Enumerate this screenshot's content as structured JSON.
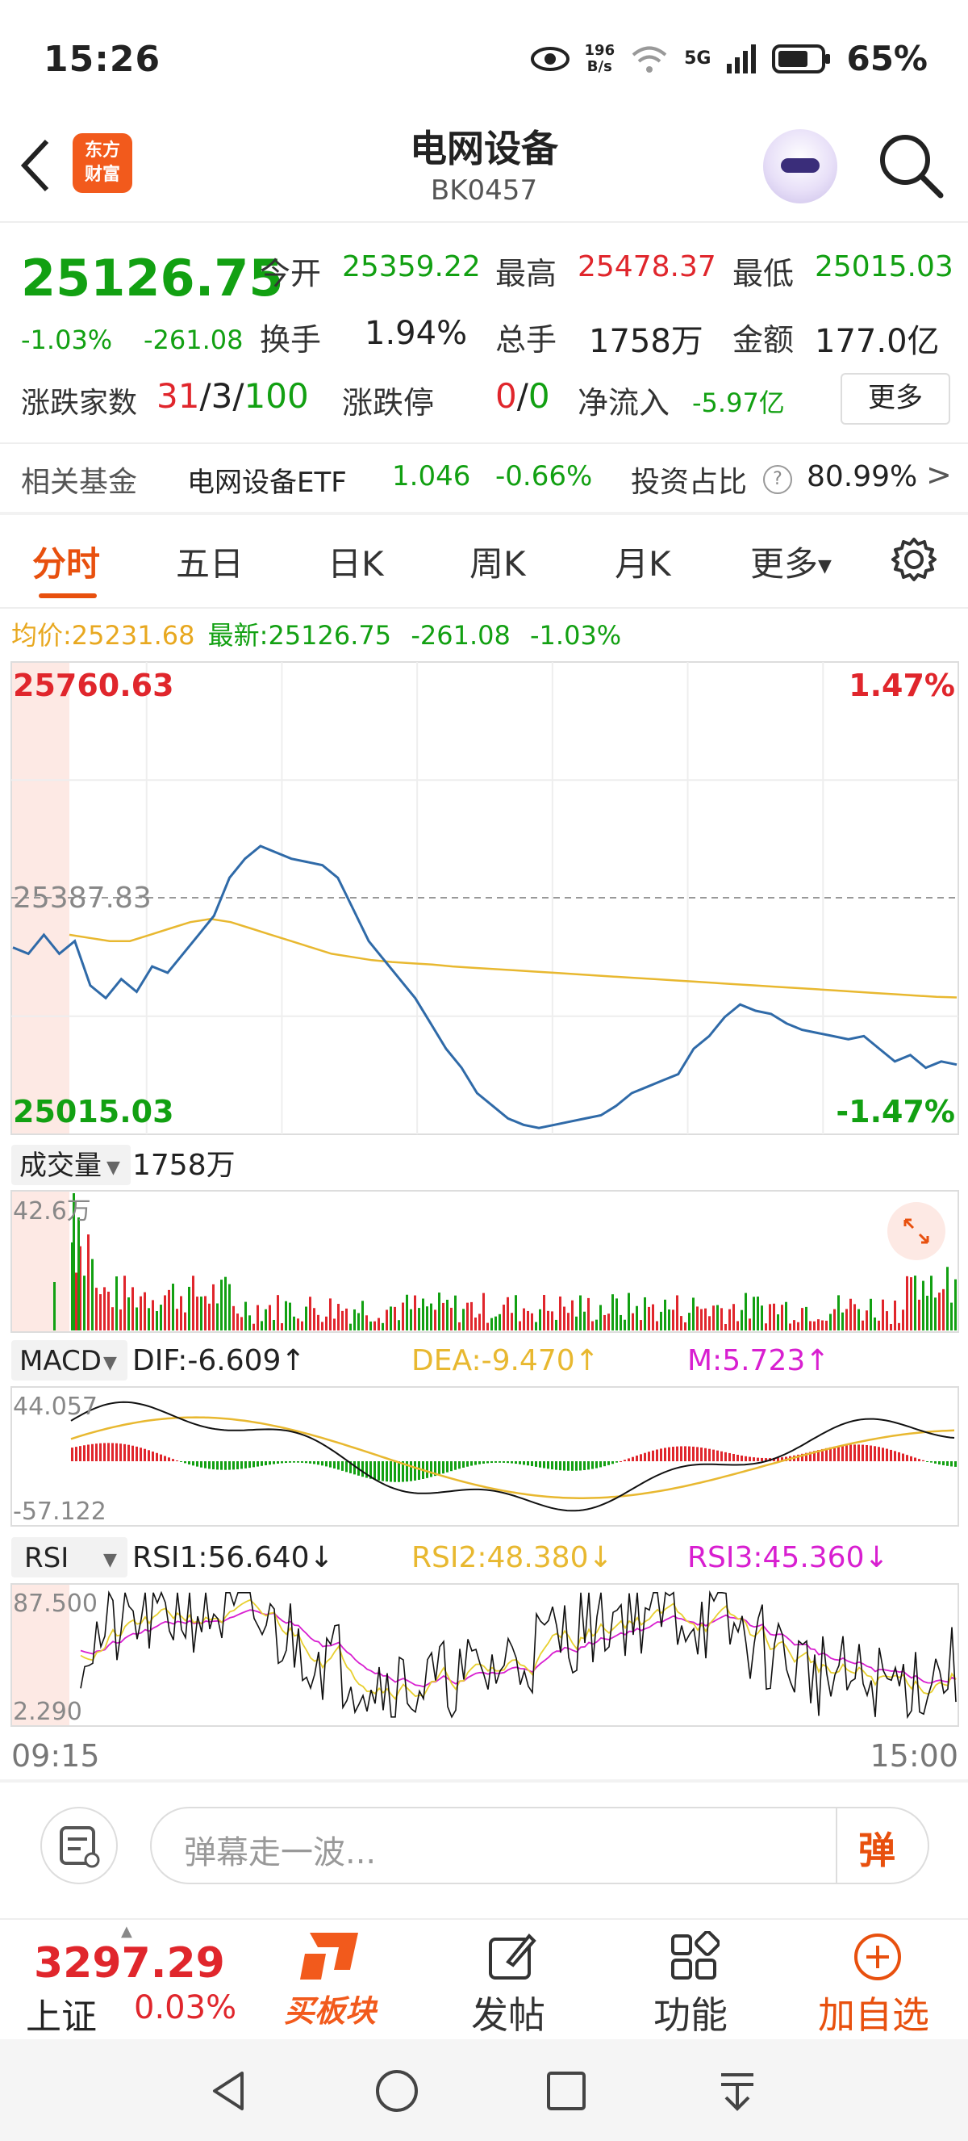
{
  "status_bar": {
    "time": "15:26",
    "net_speed_top": "196",
    "net_speed_bottom": "B/s",
    "network": "5G",
    "battery": "65%"
  },
  "header": {
    "logo_line1": "东方",
    "logo_line2": "财富",
    "title": "电网设备",
    "code": "BK0457"
  },
  "quote": {
    "price": "25126.75",
    "change_pct": "-1.03%",
    "change": "-261.08",
    "open_label": "今开",
    "open": "25359.22",
    "high_label": "最高",
    "high": "25478.37",
    "low_label": "最低",
    "low": "25015.03",
    "turnover_label": "换手",
    "turnover": "1.94%",
    "volume_label": "总手",
    "volume": "1758万",
    "amount_label": "金额",
    "amount": "177.0亿",
    "breadth_label": "涨跌家数",
    "up": "31",
    "flat": "3",
    "down": "100",
    "sep": "/",
    "limit_label": "涨跌停",
    "limit_up": "0",
    "limit_down": "0",
    "inflow_label": "净流入",
    "inflow": "-5.97亿",
    "more_button": "更多"
  },
  "fund": {
    "label": "相关基金",
    "name": "电网设备ETF",
    "price": "1.046",
    "change": "-0.66%",
    "ratio_label": "投资占比",
    "help": "?",
    "ratio": "80.99%",
    "arrow": ">"
  },
  "tabs": [
    "分时",
    "五日",
    "日K",
    "周K",
    "月K",
    "更多"
  ],
  "info_line": {
    "avg_label": "均价:",
    "avg": "25231.68",
    "latest_label": "最新:",
    "latest": "25126.75",
    "change": "-261.08",
    "pct": "-1.03%"
  },
  "chart_labels": {
    "price_top": "25760.63",
    "price_mid": "25387.83",
    "price_bottom": "25015.03",
    "pct_top": "1.47%",
    "pct_bottom": "-1.47%",
    "vol_select": "成交量",
    "vol_value": "1758万",
    "vol_max": "42.6万",
    "macd_select": "MACD",
    "dif": "DIF:-6.609↑",
    "dea": "DEA:-9.470↑",
    "m": "M:5.723↑",
    "macd_top": "44.057",
    "macd_bottom": "-57.122",
    "rsi_select": "RSI",
    "rsi1": "RSI1:56.640↓",
    "rsi2": "RSI2:48.380↓",
    "rsi3": "RSI3:45.360↓",
    "rsi_top": "87.500",
    "rsi_bottom": "2.290",
    "time_start": "09:15",
    "time_end": "15:00"
  },
  "chart_data": {
    "type": "line",
    "x": [
      "09:15",
      "15:00"
    ],
    "ylim": [
      25015.03,
      25760.63
    ],
    "reference": 25387.83,
    "series": [
      {
        "name": "最新",
        "values": [
          25310,
          25300,
          25330,
          25300,
          25320,
          25250,
          25230,
          25260,
          25240,
          25280,
          25270,
          25300,
          25330,
          25360,
          25420,
          25450,
          25470,
          25460,
          25450,
          25445,
          25440,
          25420,
          25370,
          25320,
          25290,
          25260,
          25230,
          25190,
          25150,
          25120,
          25080,
          25060,
          25040,
          25030,
          25025,
          25030,
          25035,
          25040,
          25045,
          25060,
          25080,
          25090,
          25100,
          25110,
          25150,
          25170,
          25200,
          25220,
          25210,
          25205,
          25190,
          25180,
          25175,
          25170,
          25165,
          25170,
          25150,
          25130,
          25140,
          25120,
          25130,
          25125
        ]
      },
      {
        "name": "均价",
        "values": [
          25330,
          25325,
          25320,
          25320,
          25330,
          25340,
          25350,
          25355,
          25350,
          25340,
          25330,
          25320,
          25310,
          25300,
          25295,
          25290,
          25287,
          25285,
          25283,
          25280,
          25278,
          25276,
          25274,
          25272,
          25270,
          25268,
          25266,
          25264,
          25262,
          25260,
          25258,
          25256,
          25254,
          25252,
          25250,
          25248,
          25246,
          25244,
          25242,
          25240,
          25238,
          25236,
          25234,
          25232,
          25231
        ]
      }
    ]
  },
  "bottom_bar": {
    "index_value": "3297.29",
    "index_name": "上证",
    "index_change": "0.03%",
    "buy_label": "买板块",
    "post_label": "发帖",
    "func_label": "功能",
    "add_label": "加自选"
  },
  "comment": {
    "placeholder": "弹幕走一波...",
    "danmu": "弹"
  },
  "colors": {
    "up": "#e0262c",
    "down": "#12a012",
    "accent": "#e8500e",
    "line": "#2f6aa8",
    "avg": "#e8b830"
  }
}
